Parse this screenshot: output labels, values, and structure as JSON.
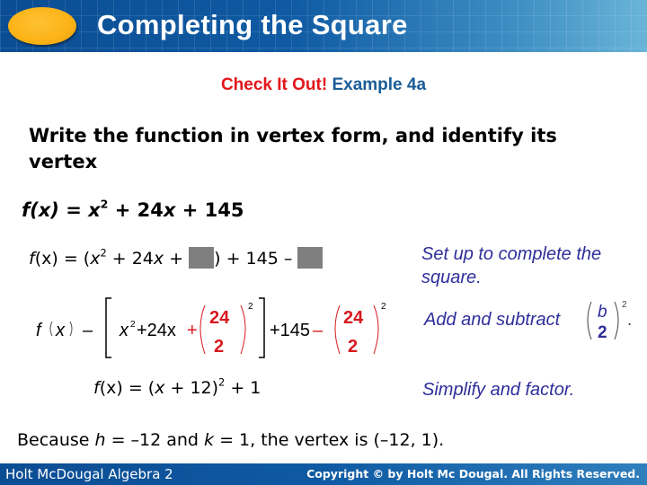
{
  "header": {
    "title": "Completing the Square"
  },
  "subtitle": {
    "check_label": "Check It Out!",
    "example_label": "Example 4a",
    "check_color": "#e3161b",
    "example_color": "#1a5c96"
  },
  "prompt": "Write the function in vertex form, and identify its vertex",
  "given": {
    "lhs": "f(x)",
    "eq": " = ",
    "x": "x",
    "exp": "2",
    "rest": " + 24",
    "x2": "x",
    "tail": " + 145"
  },
  "step1": {
    "part_a": "(x)",
    "f": "f",
    "eq_open": " = (",
    "x": "x",
    "exp": "2",
    "mid": " + 24",
    "x2": "x",
    "plus": " + ",
    "close": ") + 145 – ",
    "note": "Set up to complete the square."
  },
  "step2": {
    "f": "f",
    "paren_x": "x",
    "minus": "–",
    "x": "x",
    "exp": "2",
    "term": "+24x",
    "red_plus": "+",
    "num": "24",
    "den": "2",
    "outer_exp": "2",
    "plus145": "+145",
    "red_minus": "–",
    "note_text": "Add and subtract",
    "note_num": "b",
    "note_den": "2",
    "note_exp": "2",
    "note_period": ".",
    "red_color": "#d7191f",
    "note_color": "#2e2e9a"
  },
  "step3": {
    "f": "f",
    "arg": "(x)",
    "eq_open": " = (",
    "x": "x",
    "rest": " + 12)",
    "exp": "2",
    "tail": " + 1",
    "note": "Simplify and factor."
  },
  "conclusion": {
    "because": "Because  ",
    "h": "h",
    "h_val": " = –12 and ",
    "k": "k",
    "k_val": " = 1, the vertex is (–12, 1)."
  },
  "footer": {
    "left": "Holt McDougal Algebra 2",
    "right": "Copyright © by Holt Mc Dougal. All Rights Reserved."
  }
}
